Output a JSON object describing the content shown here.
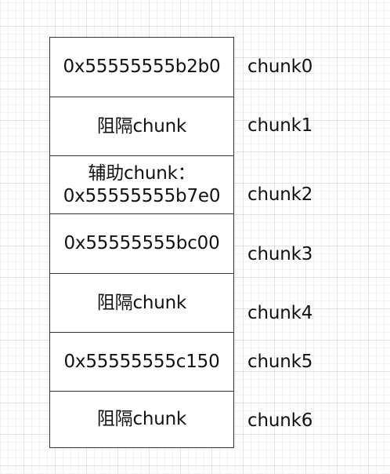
{
  "blocks": [
    {
      "lines": [
        "0x55555555b2b0"
      ],
      "label": "chunk0"
    },
    {
      "lines": [
        "阻隔chunk"
      ],
      "label": "chunk1"
    },
    {
      "lines": [
        "辅助chunk：",
        "0x55555555b7e0"
      ],
      "label": "chunk2"
    },
    {
      "lines": [
        "0x55555555bc00"
      ],
      "label": "chunk3"
    },
    {
      "lines": [
        "阻隔chunk"
      ],
      "label": "chunk4"
    },
    {
      "lines": [
        "0x55555555c150"
      ],
      "label": "chunk5"
    },
    {
      "lines": [
        "阻隔chunk"
      ],
      "label": "chunk6"
    }
  ]
}
